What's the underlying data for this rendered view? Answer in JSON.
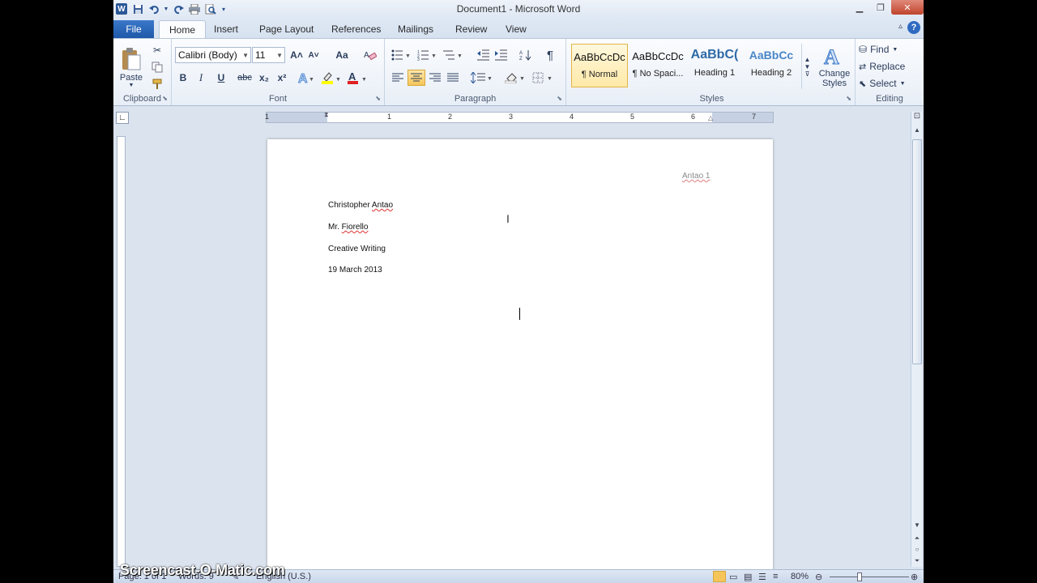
{
  "window": {
    "title": "Document1  -  Microsoft Word",
    "app_icon": "W"
  },
  "qat": {
    "icons": [
      "word-app-icon",
      "save-icon",
      "undo-icon",
      "redo-icon",
      "print-icon",
      "print-preview-icon",
      "customize-qat-icon"
    ]
  },
  "tabs": [
    {
      "label": "File"
    },
    {
      "label": "Home"
    },
    {
      "label": "Insert"
    },
    {
      "label": "Page Layout"
    },
    {
      "label": "References"
    },
    {
      "label": "Mailings"
    },
    {
      "label": "Review"
    },
    {
      "label": "View"
    }
  ],
  "ribbon": {
    "clipboard": {
      "label": "Clipboard",
      "paste": "Paste"
    },
    "font": {
      "label": "Font",
      "family": "Calibri (Body)",
      "size": "11",
      "bold": "B",
      "italic": "I",
      "underline": "U",
      "strike": "abc",
      "subscript": "x₂",
      "superscript": "x²",
      "grow": "A˄",
      "shrink": "A˅",
      "case": "Aa",
      "color": "A"
    },
    "paragraph": {
      "label": "Paragraph",
      "pilcrow": "¶"
    },
    "styles": {
      "label": "Styles",
      "items": [
        {
          "sample": "AaBbCcDc",
          "name": "¶ Normal"
        },
        {
          "sample": "AaBbCcDc",
          "name": "¶ No Spaci..."
        },
        {
          "sample": "AaBbC(",
          "name": "Heading 1"
        },
        {
          "sample": "AaBbCc",
          "name": "Heading 2"
        }
      ],
      "change_styles": "Change Styles",
      "change_styles_line1": "Change",
      "change_styles_line2": "Styles"
    },
    "editing": {
      "label": "Editing",
      "find": "Find",
      "replace": "Replace",
      "select": "Select"
    }
  },
  "ruler": {
    "labels": [
      "1",
      "1",
      "2",
      "3",
      "4",
      "5",
      "6",
      "7"
    ]
  },
  "document": {
    "header": "Antao 1",
    "lines": [
      "Christopher Antao",
      "Mr. Fiorello",
      "Creative Writing",
      "19 March 2013"
    ]
  },
  "status": {
    "page": "Page: 1 of 1",
    "words": "Words: 9",
    "language": "English (U.S.)",
    "zoom": "80%"
  },
  "watermark": "Screencast-O-Matic.com"
}
